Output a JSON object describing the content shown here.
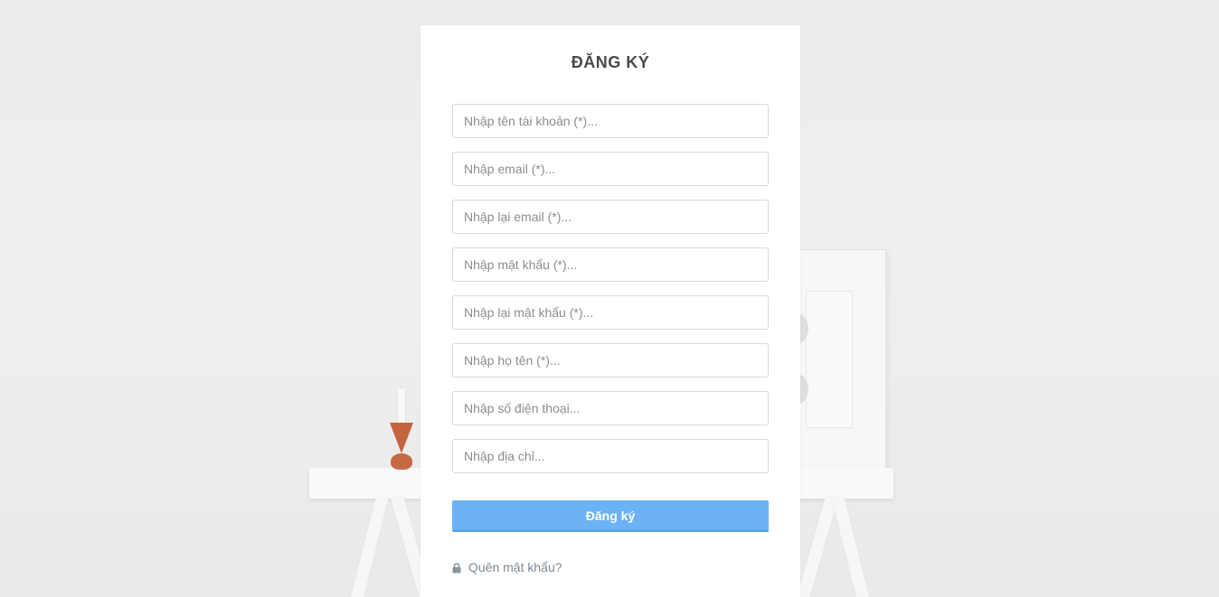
{
  "form": {
    "title": "ĐĂNG KÝ",
    "fields": [
      {
        "name": "username-input",
        "placeholder": "Nhập tên tài khoản (*)...",
        "value": ""
      },
      {
        "name": "email-input",
        "placeholder": "Nhập email (*)...",
        "value": ""
      },
      {
        "name": "confirm-email-input",
        "placeholder": "Nhập lại email (*)...",
        "value": ""
      },
      {
        "name": "password-input",
        "placeholder": "Nhập mật khẩu (*)...",
        "value": ""
      },
      {
        "name": "confirm-password-input",
        "placeholder": "Nhập lại mật khẩu (*)...",
        "value": ""
      },
      {
        "name": "fullname-input",
        "placeholder": "Nhập họ tên (*)...",
        "value": ""
      },
      {
        "name": "phone-input",
        "placeholder": "Nhập số điện thoại...",
        "value": ""
      },
      {
        "name": "address-input",
        "placeholder": "Nhập địa chỉ...",
        "value": ""
      }
    ],
    "submit_label": "Đăng ký",
    "forgot_label": "Quên mật khẩu?",
    "forgot_icon": "lock-icon"
  },
  "colors": {
    "accent": "#6cb3f5",
    "title": "#4a4a4a",
    "link": "#7f8a94"
  }
}
